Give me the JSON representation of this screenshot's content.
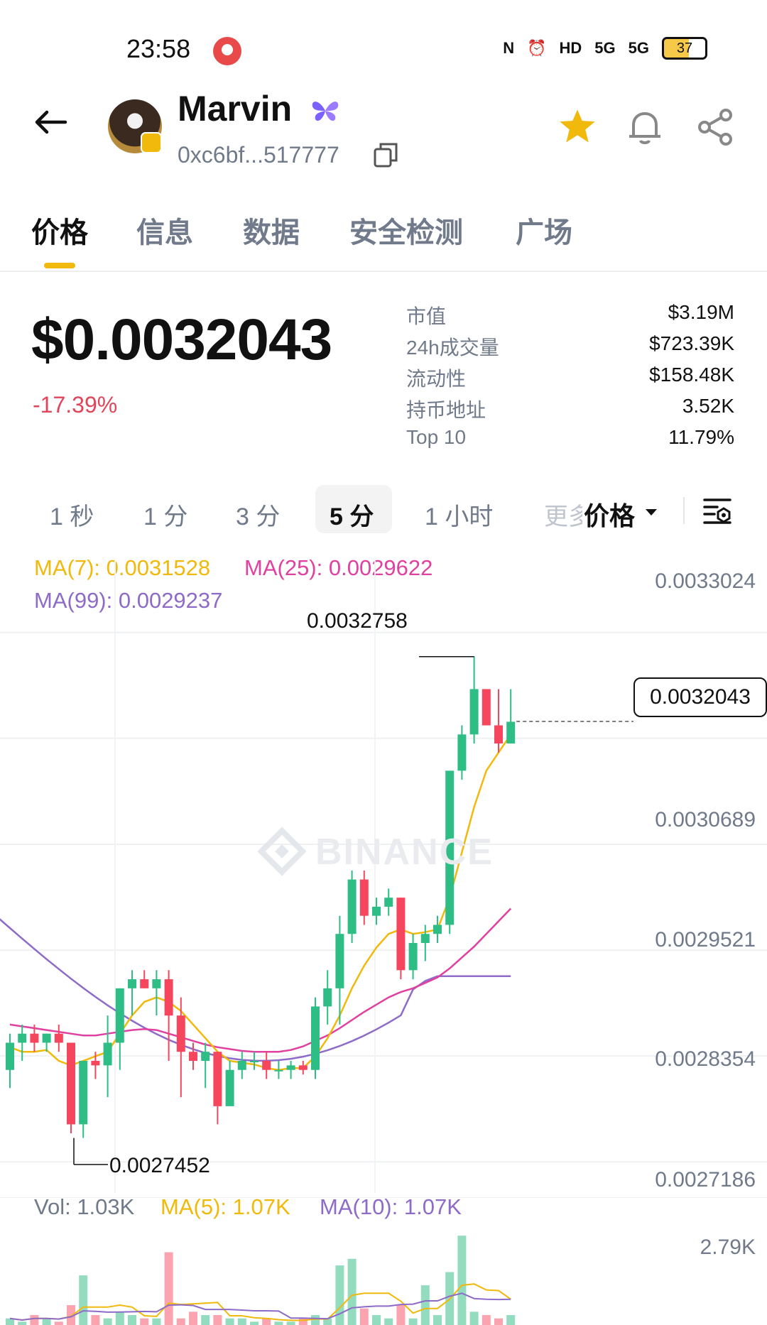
{
  "status_bar": {
    "time": "23:58",
    "battery": "37",
    "network": "5G"
  },
  "token": {
    "name": "Marvin",
    "address": "0xc6bf...517777"
  },
  "tabs": [
    "价格",
    "信息",
    "数据",
    "安全检测",
    "广场"
  ],
  "price": {
    "value": "$0.0032043",
    "change": "-17.39%"
  },
  "stats": [
    {
      "label": "市值",
      "value": "$3.19M"
    },
    {
      "label": "24h成交量",
      "value": "$723.39K"
    },
    {
      "label": "流动性",
      "value": "$158.48K"
    },
    {
      "label": "持币地址",
      "value": "3.52K"
    },
    {
      "label": "Top 10",
      "value": "11.79%"
    }
  ],
  "intervals": [
    "1 秒",
    "1 分",
    "3 分",
    "5 分",
    "1 小时"
  ],
  "interval_more": "更多",
  "active_interval": "5 分",
  "price_type": "价格",
  "ma_legend": {
    "ma7": "MA(7): 0.0031528",
    "ma25": "MA(25): 0.0029622",
    "ma99": "MA(99): 0.0029237"
  },
  "chart_labels": {
    "high": "0.0032758",
    "low": "0.0027452",
    "current": "0.0032043",
    "watermark": "BINANCE"
  },
  "y_axis": [
    "0.0033024",
    "0.0030689",
    "0.0029521",
    "0.0028354",
    "0.0027186"
  ],
  "volume_legend": {
    "vol": "Vol: 1.03K",
    "ma5": "MA(5): 1.07K",
    "ma10": "MA(10): 1.07K"
  },
  "volume_axis": "2.79K",
  "colors": {
    "up": "#2ebd85",
    "down": "#f6465d",
    "ma7": "#f0b90b",
    "ma25": "#e040a0",
    "ma99": "#8e6bc8",
    "accent": "#f0b90b"
  },
  "chart_data": {
    "type": "candlestick",
    "y_unit": "USD",
    "ylim": [
      0.0027,
      0.00335
    ],
    "candles": [
      {
        "o": 0.00282,
        "h": 0.00286,
        "l": 0.0028,
        "c": 0.00285
      },
      {
        "o": 0.00285,
        "h": 0.00287,
        "l": 0.00283,
        "c": 0.00286
      },
      {
        "o": 0.00286,
        "h": 0.00287,
        "l": 0.00284,
        "c": 0.00285
      },
      {
        "o": 0.00285,
        "h": 0.00286,
        "l": 0.00284,
        "c": 0.00286
      },
      {
        "o": 0.00286,
        "h": 0.00287,
        "l": 0.00284,
        "c": 0.00285
      },
      {
        "o": 0.00285,
        "h": 0.00285,
        "l": 0.00275,
        "c": 0.00276
      },
      {
        "o": 0.00276,
        "h": 0.00283,
        "l": 0.002745,
        "c": 0.00283
      },
      {
        "o": 0.00283,
        "h": 0.00284,
        "l": 0.00281,
        "c": 0.002825
      },
      {
        "o": 0.002825,
        "h": 0.00288,
        "l": 0.00279,
        "c": 0.00285
      },
      {
        "o": 0.00285,
        "h": 0.00291,
        "l": 0.00282,
        "c": 0.00291
      },
      {
        "o": 0.00291,
        "h": 0.00293,
        "l": 0.00288,
        "c": 0.00292
      },
      {
        "o": 0.00292,
        "h": 0.00293,
        "l": 0.00291,
        "c": 0.00291
      },
      {
        "o": 0.00291,
        "h": 0.00293,
        "l": 0.00288,
        "c": 0.00292
      },
      {
        "o": 0.00292,
        "h": 0.00293,
        "l": 0.00283,
        "c": 0.00288
      },
      {
        "o": 0.00288,
        "h": 0.0029,
        "l": 0.00279,
        "c": 0.00284
      },
      {
        "o": 0.00284,
        "h": 0.00285,
        "l": 0.00282,
        "c": 0.00283
      },
      {
        "o": 0.00283,
        "h": 0.00285,
        "l": 0.0028,
        "c": 0.00284
      },
      {
        "o": 0.00284,
        "h": 0.00284,
        "l": 0.00276,
        "c": 0.00278
      },
      {
        "o": 0.00278,
        "h": 0.00283,
        "l": 0.00278,
        "c": 0.00282
      },
      {
        "o": 0.00282,
        "h": 0.00284,
        "l": 0.00281,
        "c": 0.00283
      },
      {
        "o": 0.00283,
        "h": 0.00284,
        "l": 0.00282,
        "c": 0.00283
      },
      {
        "o": 0.00283,
        "h": 0.00284,
        "l": 0.00281,
        "c": 0.00282
      },
      {
        "o": 0.00282,
        "h": 0.00283,
        "l": 0.00281,
        "c": 0.00282
      },
      {
        "o": 0.00282,
        "h": 0.00283,
        "l": 0.00281,
        "c": 0.002825
      },
      {
        "o": 0.002825,
        "h": 0.00283,
        "l": 0.002815,
        "c": 0.00282
      },
      {
        "o": 0.00282,
        "h": 0.0029,
        "l": 0.00281,
        "c": 0.00289
      },
      {
        "o": 0.00289,
        "h": 0.00293,
        "l": 0.00287,
        "c": 0.00291
      },
      {
        "o": 0.00291,
        "h": 0.00299,
        "l": 0.00287,
        "c": 0.00297
      },
      {
        "o": 0.00297,
        "h": 0.00304,
        "l": 0.00296,
        "c": 0.00303
      },
      {
        "o": 0.00303,
        "h": 0.00304,
        "l": 0.00298,
        "c": 0.00299
      },
      {
        "o": 0.00299,
        "h": 0.00301,
        "l": 0.00298,
        "c": 0.003
      },
      {
        "o": 0.003,
        "h": 0.00302,
        "l": 0.00299,
        "c": 0.00301
      },
      {
        "o": 0.00301,
        "h": 0.00301,
        "l": 0.00292,
        "c": 0.00293
      },
      {
        "o": 0.00293,
        "h": 0.00297,
        "l": 0.00292,
        "c": 0.00296
      },
      {
        "o": 0.00296,
        "h": 0.00298,
        "l": 0.00294,
        "c": 0.00297
      },
      {
        "o": 0.00297,
        "h": 0.00299,
        "l": 0.00296,
        "c": 0.00298
      },
      {
        "o": 0.00298,
        "h": 0.00305,
        "l": 0.00297,
        "c": 0.00315
      },
      {
        "o": 0.00315,
        "h": 0.0032,
        "l": 0.00314,
        "c": 0.00319
      },
      {
        "o": 0.00319,
        "h": 0.003276,
        "l": 0.00318,
        "c": 0.00324
      },
      {
        "o": 0.00324,
        "h": 0.00324,
        "l": 0.0032,
        "c": 0.0032
      },
      {
        "o": 0.0032,
        "h": 0.00324,
        "l": 0.00317,
        "c": 0.00318
      },
      {
        "o": 0.00318,
        "h": 0.00324,
        "l": 0.00318,
        "c": 0.003204
      }
    ],
    "ma7": [
      0.002845,
      0.00284,
      0.00284,
      0.002842,
      0.00283,
      0.002825,
      0.00283,
      0.002835,
      0.00284,
      0.00286,
      0.00288,
      0.002895,
      0.0029,
      0.002895,
      0.002885,
      0.00287,
      0.002855,
      0.00284,
      0.00283,
      0.002828,
      0.002826,
      0.002822,
      0.00282,
      0.002822,
      0.002822,
      0.002835,
      0.002855,
      0.00288,
      0.00291,
      0.002935,
      0.002955,
      0.00297,
      0.002975,
      0.00297,
      0.002972,
      0.002975,
      0.00301,
      0.00306,
      0.00311,
      0.00315,
      0.00317,
      0.00319
    ],
    "ma25": [
      0.00287,
      0.002868,
      0.002866,
      0.002864,
      0.002862,
      0.00286,
      0.002858,
      0.002858,
      0.00286,
      0.002862,
      0.002864,
      0.002865,
      0.002864,
      0.00286,
      0.002856,
      0.002852,
      0.002848,
      0.002845,
      0.002843,
      0.002841,
      0.00284,
      0.00284,
      0.00284,
      0.002842,
      0.002846,
      0.002852,
      0.002858,
      0.002866,
      0.002875,
      0.002884,
      0.002892,
      0.0029,
      0.002906,
      0.00291,
      0.002916,
      0.002922,
      0.002932,
      0.002944,
      0.002956,
      0.00297,
      0.002984,
      0.002998
    ],
    "ma99_visible": true,
    "volume_ylim": [
      0,
      2.79
    ],
    "volume": [
      0.2,
      0.1,
      0.3,
      0.2,
      0.1,
      0.6,
      1.5,
      0.3,
      0.2,
      0.4,
      0.3,
      0.2,
      0.2,
      2.2,
      0.2,
      0.4,
      0.3,
      0.3,
      0.2,
      0.2,
      0.1,
      0.2,
      0.1,
      0.1,
      0.2,
      0.3,
      0.2,
      1.8,
      2.0,
      0.5,
      0.3,
      0.2,
      0.6,
      0.2,
      1.2,
      0.3,
      1.6,
      2.7,
      0.4,
      0.3,
      0.2,
      0.3
    ]
  }
}
